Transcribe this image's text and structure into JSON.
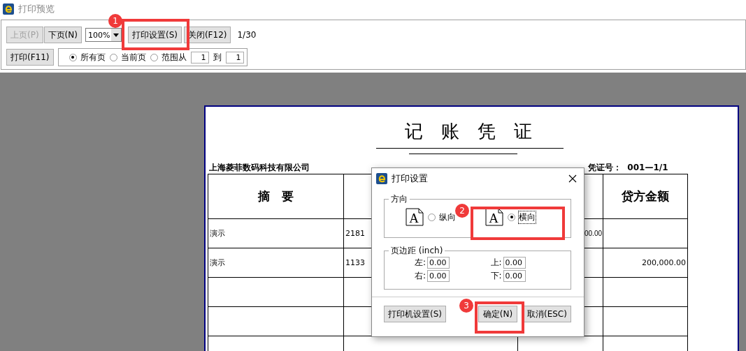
{
  "window": {
    "title": "打印预览"
  },
  "toolbar": {
    "nav_buttons": [
      {
        "label": "上页(P)",
        "disabled": true
      },
      {
        "label": "下页(N)",
        "disabled": false
      }
    ],
    "zoom": "100%",
    "print_setup_button": "打印设置(S)",
    "close_button": "关闭(F12)",
    "page_indicator": "1/30",
    "print_button": "打印(F11)",
    "page_range": {
      "options": [
        {
          "label": "所有页",
          "selected": true
        },
        {
          "label": "当前页",
          "selected": false
        },
        {
          "label": "范围从",
          "selected": false
        }
      ],
      "from": "1",
      "to_label": "到",
      "to": "1"
    }
  },
  "document": {
    "title": "记　账　凭　证",
    "company": "上海菱菲数码科技有限公司",
    "voucher_no": "凭证号：  001—1/1",
    "column_1": "摘　要",
    "column_4": "贷方金额",
    "rows": [
      {
        "column_1": "演示",
        "column_2": "2181",
        "column_3": "00.00"
      },
      {
        "column_1": "演示",
        "column_2": "1133",
        "column_4": "200,000.00"
      }
    ]
  },
  "dialog": {
    "title": "打印设置",
    "orientation": {
      "legend": "方向",
      "options": [
        {
          "icon_letter": "A",
          "label": "纵向",
          "selected": false
        },
        {
          "icon_letter": "A",
          "label": "横向",
          "selected": true
        }
      ]
    },
    "margins": {
      "legend": "页边距 (inch)",
      "fields": [
        {
          "label": "左:",
          "value": "0.00"
        },
        {
          "label": "上:",
          "value": "0.00"
        },
        {
          "label": "右:",
          "value": "0.00"
        },
        {
          "label": "下:",
          "value": "0.00"
        }
      ]
    },
    "buttons": [
      {
        "label": "打印机设置(S)"
      },
      {
        "label": "确定(N)"
      },
      {
        "label": "取消(ESC)"
      }
    ]
  },
  "annotations": [
    {
      "number": "1"
    },
    {
      "number": "2"
    },
    {
      "number": "3"
    }
  ]
}
